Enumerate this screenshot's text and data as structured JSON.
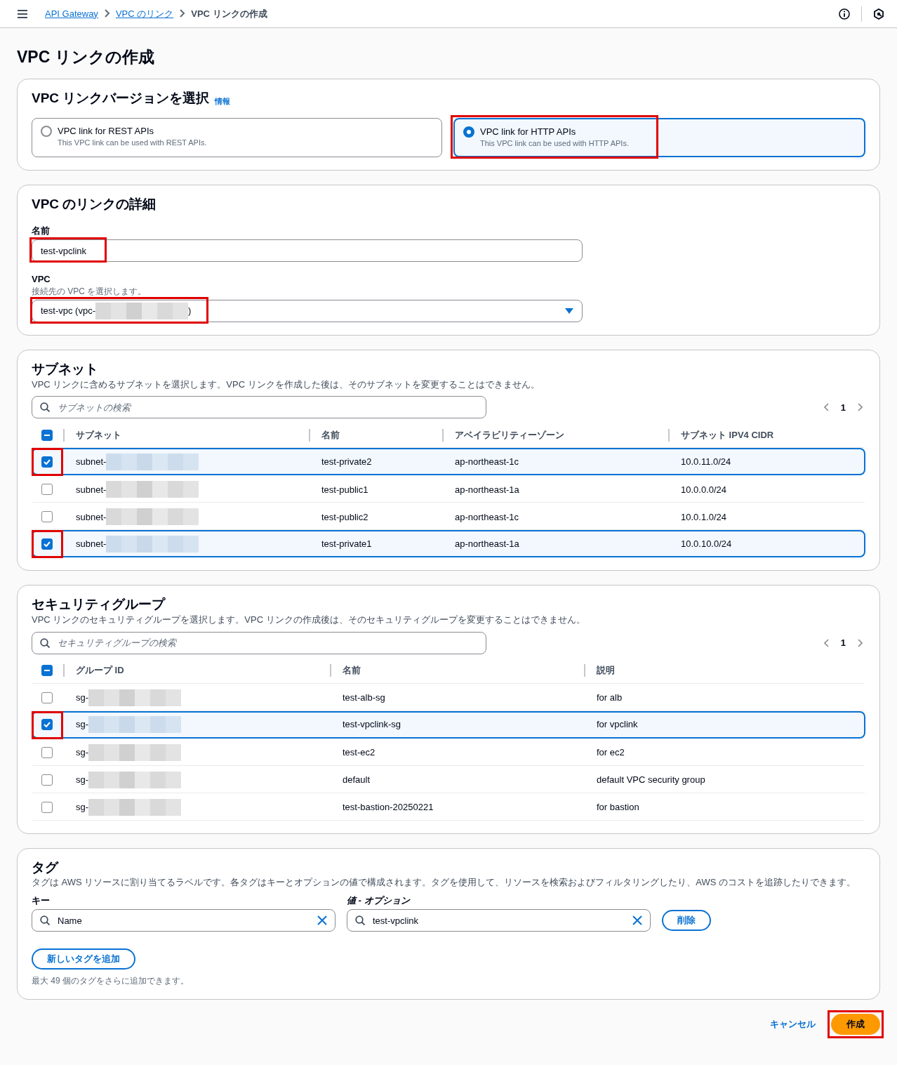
{
  "breadcrumbs": [
    {
      "label": "API Gateway",
      "link": true
    },
    {
      "label": "VPC のリンク",
      "link": true
    },
    {
      "label": "VPC リンクの作成",
      "link": false
    }
  ],
  "page_title": "VPC リンクの作成",
  "version_panel": {
    "title": "VPC リンクバージョンを選択",
    "info": "情報",
    "options": [
      {
        "label": "VPC link for REST APIs",
        "description": "This VPC link can be used with REST APIs.",
        "selected": false,
        "highlighted": false
      },
      {
        "label": "VPC link for HTTP APIs",
        "description": "This VPC link can be used with HTTP APIs.",
        "selected": true,
        "highlighted": true
      }
    ]
  },
  "details_panel": {
    "title": "VPC のリンクの詳細",
    "name_field": {
      "label": "名前",
      "value": "test-vpclink",
      "highlighted": true
    },
    "vpc_field": {
      "label": "VPC",
      "description": "接続先の VPC を選択します。",
      "value_prefix": "test-vpc (vpc-",
      "value_suffix": ")",
      "highlighted": true
    }
  },
  "subnets": {
    "title": "サブネット",
    "description": "VPC リンクに含めるサブネットを選択します。VPC リンクを作成した後は、そのサブネットを変更することはできません。",
    "search": {
      "placeholder": "サブネットの検索"
    },
    "page": "1",
    "header_checkbox": {
      "indeterminate": true
    },
    "columns": [
      "サブネット",
      "名前",
      "アベイラビリティーゾーン",
      "サブネット IPV4 CIDR"
    ],
    "rows": [
      {
        "cells": [
          "subnet-",
          "test-private2",
          "ap-northeast-1c",
          "10.0.11.0/24"
        ],
        "selected": true,
        "highlighted": true
      },
      {
        "cells": [
          "subnet-",
          "test-public1",
          "ap-northeast-1a",
          "10.0.0.0/24"
        ],
        "selected": false,
        "highlighted": false
      },
      {
        "cells": [
          "subnet-",
          "test-public2",
          "ap-northeast-1c",
          "10.0.1.0/24"
        ],
        "selected": false,
        "highlighted": false
      },
      {
        "cells": [
          "subnet-",
          "test-private1",
          "ap-northeast-1a",
          "10.0.10.0/24"
        ],
        "selected": true,
        "highlighted": true
      }
    ]
  },
  "security_groups": {
    "title": "セキュリティグループ",
    "description": "VPC リンクのセキュリティグループを選択します。VPC リンクの作成後は、そのセキュリティグループを変更することはできません。",
    "search": {
      "placeholder": "セキュリティグループの検索"
    },
    "page": "1",
    "header_checkbox": {
      "indeterminate": true
    },
    "columns": [
      "グループ ID",
      "名前",
      "説明"
    ],
    "rows": [
      {
        "cells": [
          "sg-",
          "test-alb-sg",
          "for alb"
        ],
        "selected": false,
        "highlighted": false
      },
      {
        "cells": [
          "sg-",
          "test-vpclink-sg",
          "for vpclink"
        ],
        "selected": true,
        "highlighted": true
      },
      {
        "cells": [
          "sg-",
          "test-ec2",
          "for ec2"
        ],
        "selected": false,
        "highlighted": false
      },
      {
        "cells": [
          "sg-",
          "default",
          "default VPC security group"
        ],
        "selected": false,
        "highlighted": false
      },
      {
        "cells": [
          "sg-",
          "test-bastion-20250221",
          "for bastion"
        ],
        "selected": false,
        "highlighted": false
      }
    ]
  },
  "tags": {
    "title": "タグ",
    "description": "タグは AWS リソースに割り当てるラベルです。各タグはキーとオプションの値で構成されます。タグを使用して、リソースを検索およびフィルタリングしたり、AWS のコストを追跡したりできます。",
    "key_label": "キー",
    "value_label": "値 - オプション",
    "items": [
      {
        "key": "Name",
        "value": "test-vpclink",
        "remove": "削除"
      }
    ],
    "add_button": "新しいタグを追加",
    "hint": "最大 49 個のタグをさらに追加できます。"
  },
  "footer": {
    "cancel": "キャンセル",
    "create": "作成",
    "create_highlighted": true
  }
}
